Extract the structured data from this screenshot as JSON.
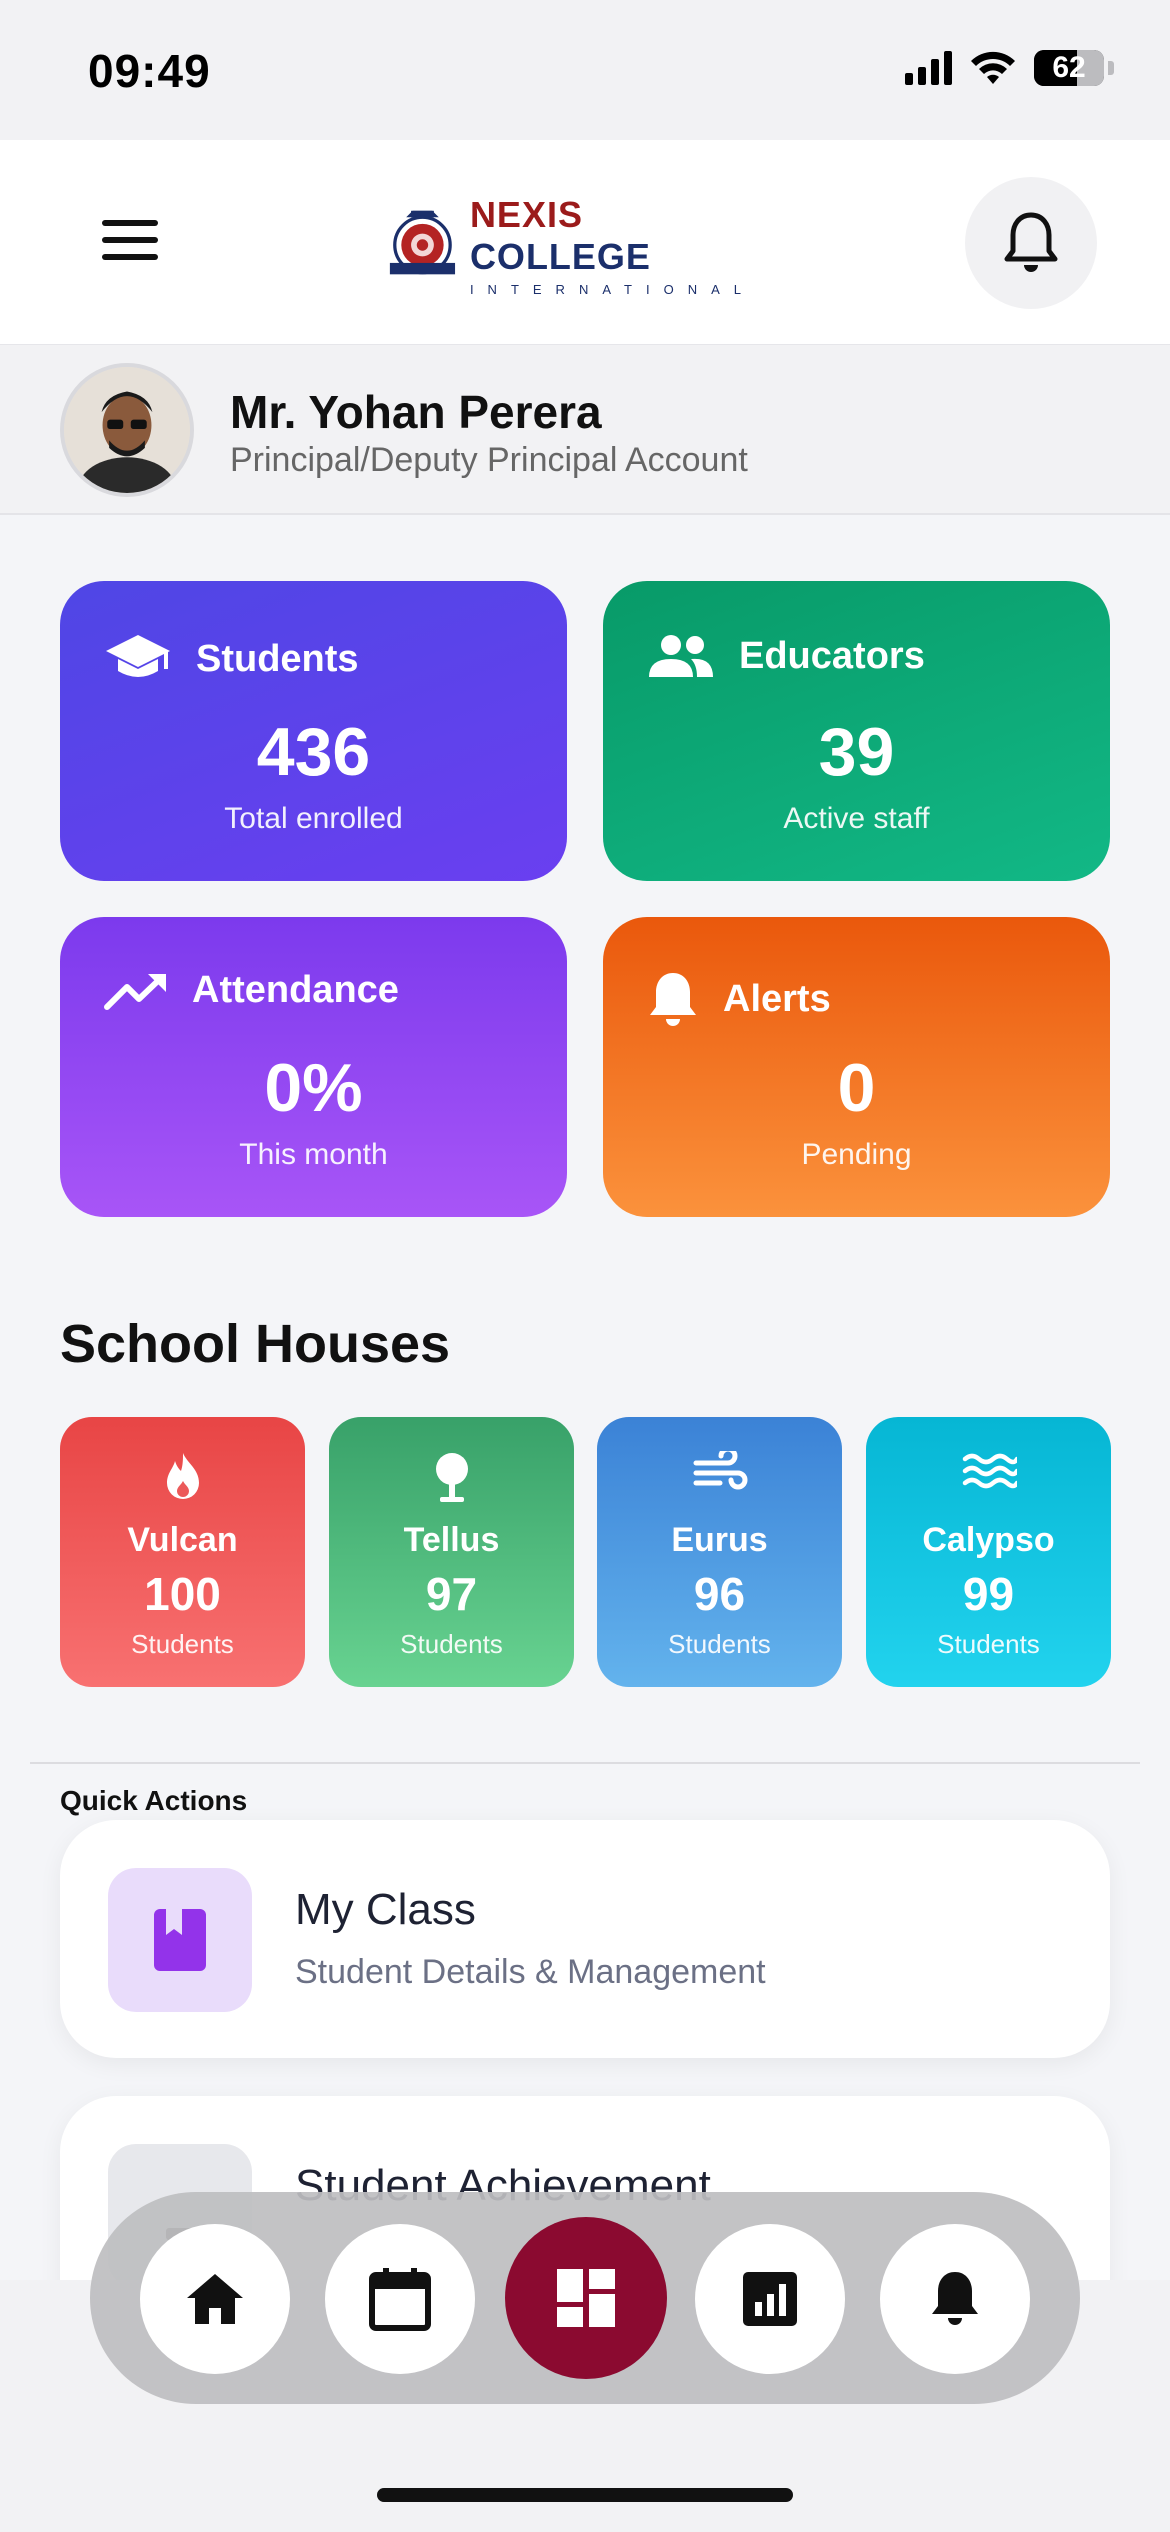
{
  "status_bar": {
    "time": "09:49",
    "battery": "62",
    "icons": [
      "cellular-signal-icon",
      "wifi-icon",
      "battery-icon"
    ]
  },
  "header": {
    "menu_icon": "menu-icon",
    "logo": {
      "name_part1": "NEXIS",
      "name_part2": " COLLEGE",
      "subtitle": "INTERNATIONAL"
    },
    "notification_icon": "bell-icon"
  },
  "profile": {
    "name": "Mr. Yohan Perera",
    "role": "Principal/Deputy Principal Account"
  },
  "stats": [
    {
      "title": "Students",
      "value": "436",
      "sub": "Total enrolled",
      "icon": "graduation-cap-icon"
    },
    {
      "title": "Educators",
      "value": "39",
      "sub": "Active staff",
      "icon": "people-icon"
    },
    {
      "title": "Attendance",
      "value": "0%",
      "sub": "This month",
      "icon": "trending-up-icon"
    },
    {
      "title": "Alerts",
      "value": "0",
      "sub": "Pending",
      "icon": "bell-icon"
    }
  ],
  "houses_section": {
    "title": "School Houses",
    "houses": [
      {
        "name": "Vulcan",
        "count": "100",
        "label": "Students",
        "icon": "fire-icon",
        "color": "#e84545"
      },
      {
        "name": "Tellus",
        "count": "97",
        "label": "Students",
        "icon": "tree-icon",
        "color": "#38a169"
      },
      {
        "name": "Eurus",
        "count": "96",
        "label": "Students",
        "icon": "wind-icon",
        "color": "#3b82d6"
      },
      {
        "name": "Calypso",
        "count": "99",
        "label": "Students",
        "icon": "waves-icon",
        "color": "#06b6d4"
      }
    ]
  },
  "quick_actions": {
    "label": "Quick Actions",
    "items": [
      {
        "title": "My Class",
        "desc": "Student Details & Management",
        "icon": "book-icon"
      },
      {
        "title": "Student Achievement",
        "desc": "",
        "icon": "trophy-icon"
      }
    ]
  },
  "tab_bar": {
    "items": [
      "home-icon",
      "calendar-icon",
      "dashboard-icon",
      "reports-icon",
      "bell-icon"
    ],
    "active": "dashboard-icon",
    "active_color": "#8b0a30"
  }
}
